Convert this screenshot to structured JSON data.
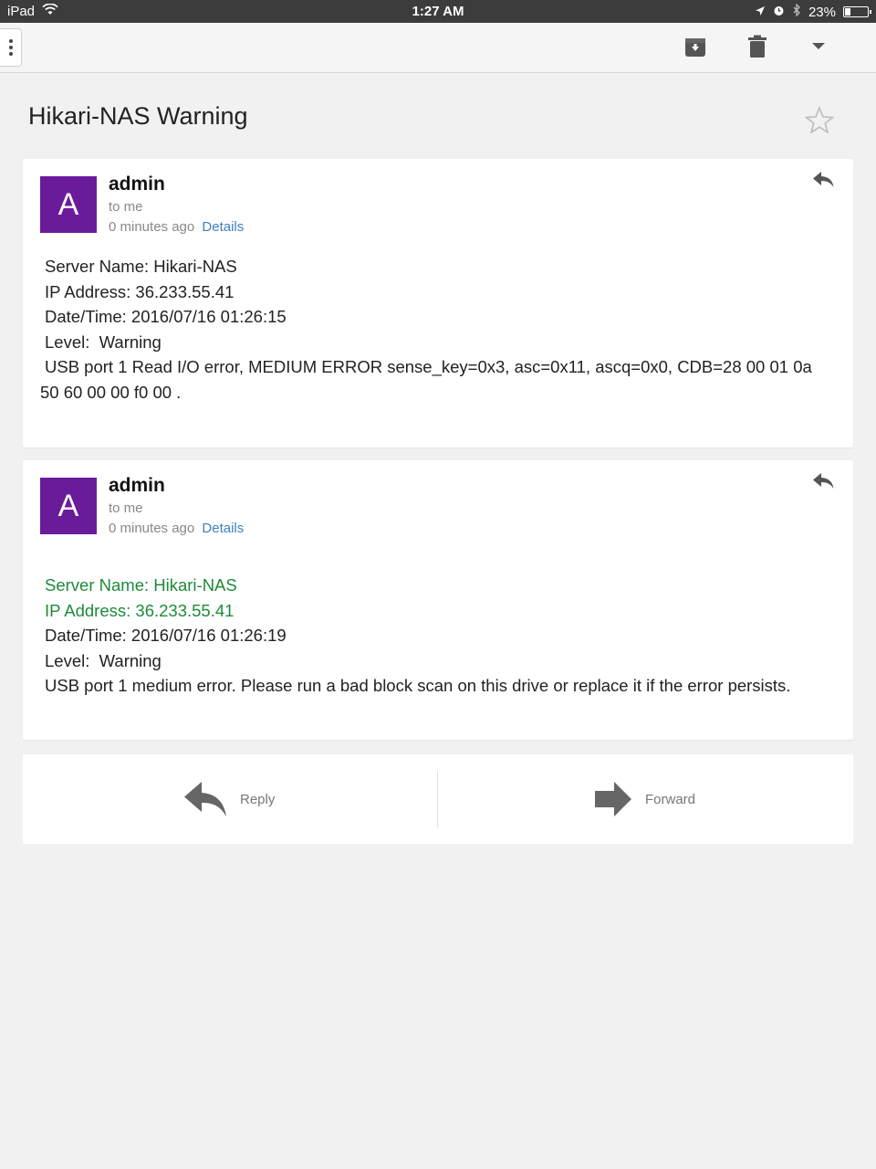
{
  "status_bar": {
    "device": "iPad",
    "time": "1:27 AM",
    "battery": "23%"
  },
  "toolbar": {
    "icons": [
      "more-vert-icon",
      "archive-icon",
      "trash-icon",
      "dropdown-arrow-icon"
    ]
  },
  "subject": "Hikari-NAS Warning",
  "messages": [
    {
      "avatar_letter": "A",
      "avatar_color": "#6a1b9a",
      "sender": "admin",
      "to": "to me",
      "time": "0 minutes ago",
      "details_label": "Details",
      "lines": [
        "Server Name: Hikari-NAS",
        "IP Address: 36.233.55.41",
        "Date/Time: 2016/07/16 01:26:15",
        "Level:  Warning",
        "USB port 1 Read I/O error, MEDIUM ERROR sense_key=0x3, asc=0x11, ascq=0x0, CDB=28 00 01 0a 50 60 00 00 f0 00 ."
      ]
    },
    {
      "avatar_letter": "A",
      "avatar_color": "#6a1b9a",
      "sender": "admin",
      "to": "to me",
      "time": "0 minutes ago",
      "details_label": "Details",
      "lines": [
        "Server Name: Hikari-NAS",
        "IP Address: 36.233.55.41",
        "Date/Time: 2016/07/16 01:26:19",
        "Level:  Warning",
        "USB port 1 medium error. Please run a bad block scan on this drive or replace it if the error persists."
      ],
      "highlight_color": "#1e8a3a"
    }
  ],
  "actions": {
    "reply_label": "Reply",
    "forward_label": "Forward"
  }
}
